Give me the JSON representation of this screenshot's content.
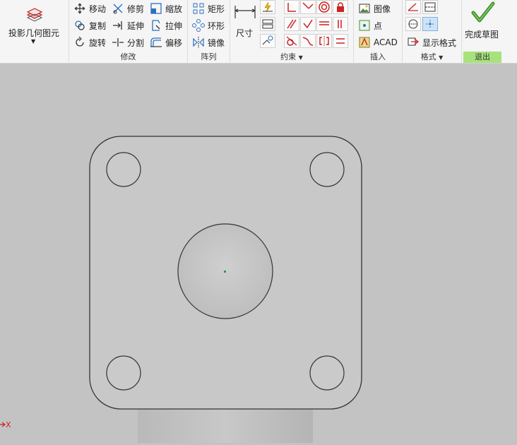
{
  "ribbon": {
    "project": {
      "label": "投影几何图元",
      "icon": "project-geometry-icon"
    },
    "modify": {
      "title": "修改",
      "move": "移动",
      "trim": "修剪",
      "scale": "缩放",
      "copy": "复制",
      "extend": "延伸",
      "stretch": "拉伸",
      "rotate": "旋转",
      "split": "分割",
      "offset": "偏移"
    },
    "pattern": {
      "title": "阵列",
      "rect": "矩形",
      "circ": "环形",
      "mirror": "镜像"
    },
    "constrain": {
      "title": "约束",
      "dimension": "尺寸"
    },
    "insert": {
      "title": "插入",
      "image": "图像",
      "point": "点",
      "acad": "ACAD"
    },
    "format": {
      "title": "格式",
      "show_format": "显示格式"
    },
    "finish": {
      "label": "完成草图",
      "exit_title": "退出"
    }
  },
  "canvas": {
    "axis_label": "X",
    "colors": {
      "background": "#c3c3c3",
      "plate": "#c8c8c8",
      "edge": "#333333",
      "accent": "#2c9a3a",
      "axis": "#d02020"
    }
  }
}
